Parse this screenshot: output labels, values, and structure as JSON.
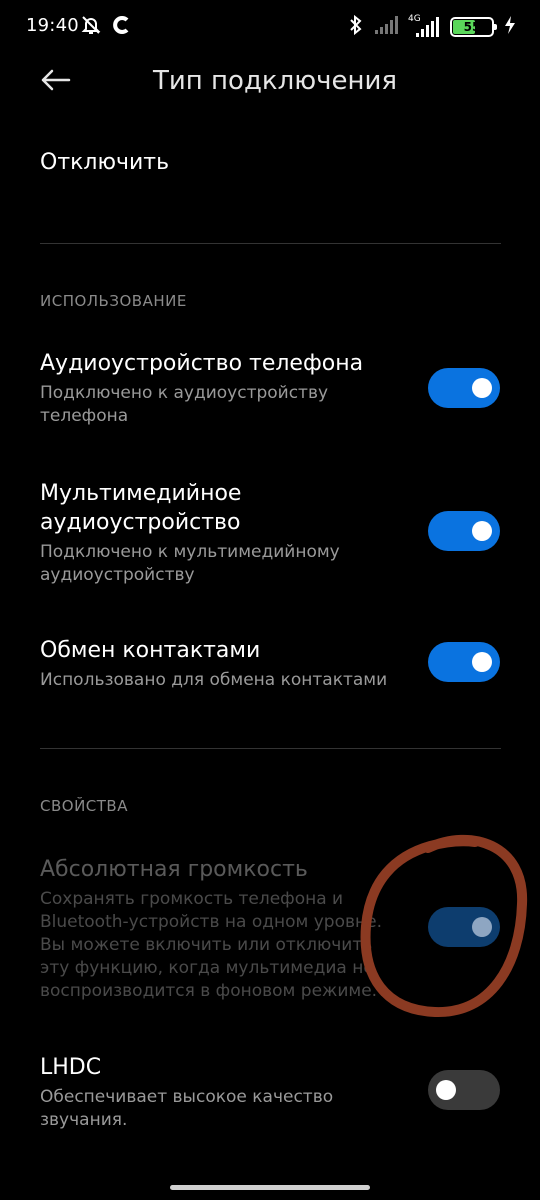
{
  "status_bar": {
    "time": "19:40",
    "battery": "55",
    "network": "4G",
    "icons": [
      "mute-icon",
      "app-c-icon",
      "bluetooth-icon",
      "signal-icon",
      "signal-4g-icon",
      "battery-icon",
      "charging-icon"
    ]
  },
  "header": {
    "title": "Тип подключения",
    "back_icon": "arrow-left-icon"
  },
  "disconnect_label": "Отключить",
  "sections": {
    "usage": {
      "label": "ИСПОЛЬЗОВАНИЕ",
      "items": [
        {
          "title": "Аудиоустройство телефона",
          "desc": "Подключено к аудиоустройству телефона",
          "enabled": true
        },
        {
          "title": "Мультимедийное аудиоустройство",
          "desc": "Подключено к мультимедийному аудиоустройству",
          "enabled": true
        },
        {
          "title": "Обмен контактами",
          "desc": "Использовано для обмена контактами",
          "enabled": true
        }
      ]
    },
    "properties": {
      "label": "СВОЙСТВА",
      "items": [
        {
          "title": "Абсолютная громкость",
          "desc": "Сохранять громкость телефона и Bluetooth-устройств на одном уровне. Вы можете включить или отключить эту функцию, когда мультимедиа не воспроизводится в фоновом режиме.",
          "enabled": true,
          "disabled_state": true
        },
        {
          "title": "LHDC",
          "desc": "Обеспечивает высокое качество звучания.",
          "enabled": false
        }
      ]
    }
  },
  "colors": {
    "accent": "#0a73e0",
    "annotation": "#8b3a22"
  }
}
